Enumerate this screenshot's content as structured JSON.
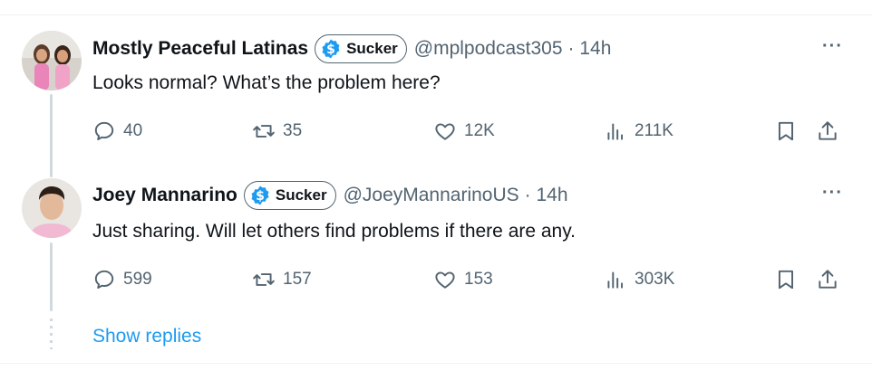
{
  "tweets": [
    {
      "author": "Mostly Peaceful Latinas",
      "badge": "Sucker",
      "handle": "@mplpodcast305",
      "time": "· 14h",
      "text": "Looks normal? What’s the problem here?",
      "more": "···",
      "replies": "40",
      "retweets": "35",
      "likes": "12K",
      "views": "211K"
    },
    {
      "author": "Joey Mannarino",
      "badge": "Sucker",
      "handle": "@JoeyMannarinoUS",
      "time": "· 14h",
      "text": "Just sharing. Will let others find problems if there are any.",
      "more": "···",
      "replies": "599",
      "retweets": "157",
      "likes": "153",
      "views": "303K"
    }
  ],
  "show_replies": "Show replies",
  "colors": {
    "link": "#1d9bf0",
    "secondary_text": "#536471",
    "badge_blue": "#1d9bf0",
    "thread_line": "#cfd9de"
  },
  "icons": [
    "reply-icon",
    "retweet-icon",
    "heart-icon",
    "views-icon",
    "bookmark-icon",
    "share-icon",
    "dollar-badge-icon",
    "more-icon"
  ]
}
